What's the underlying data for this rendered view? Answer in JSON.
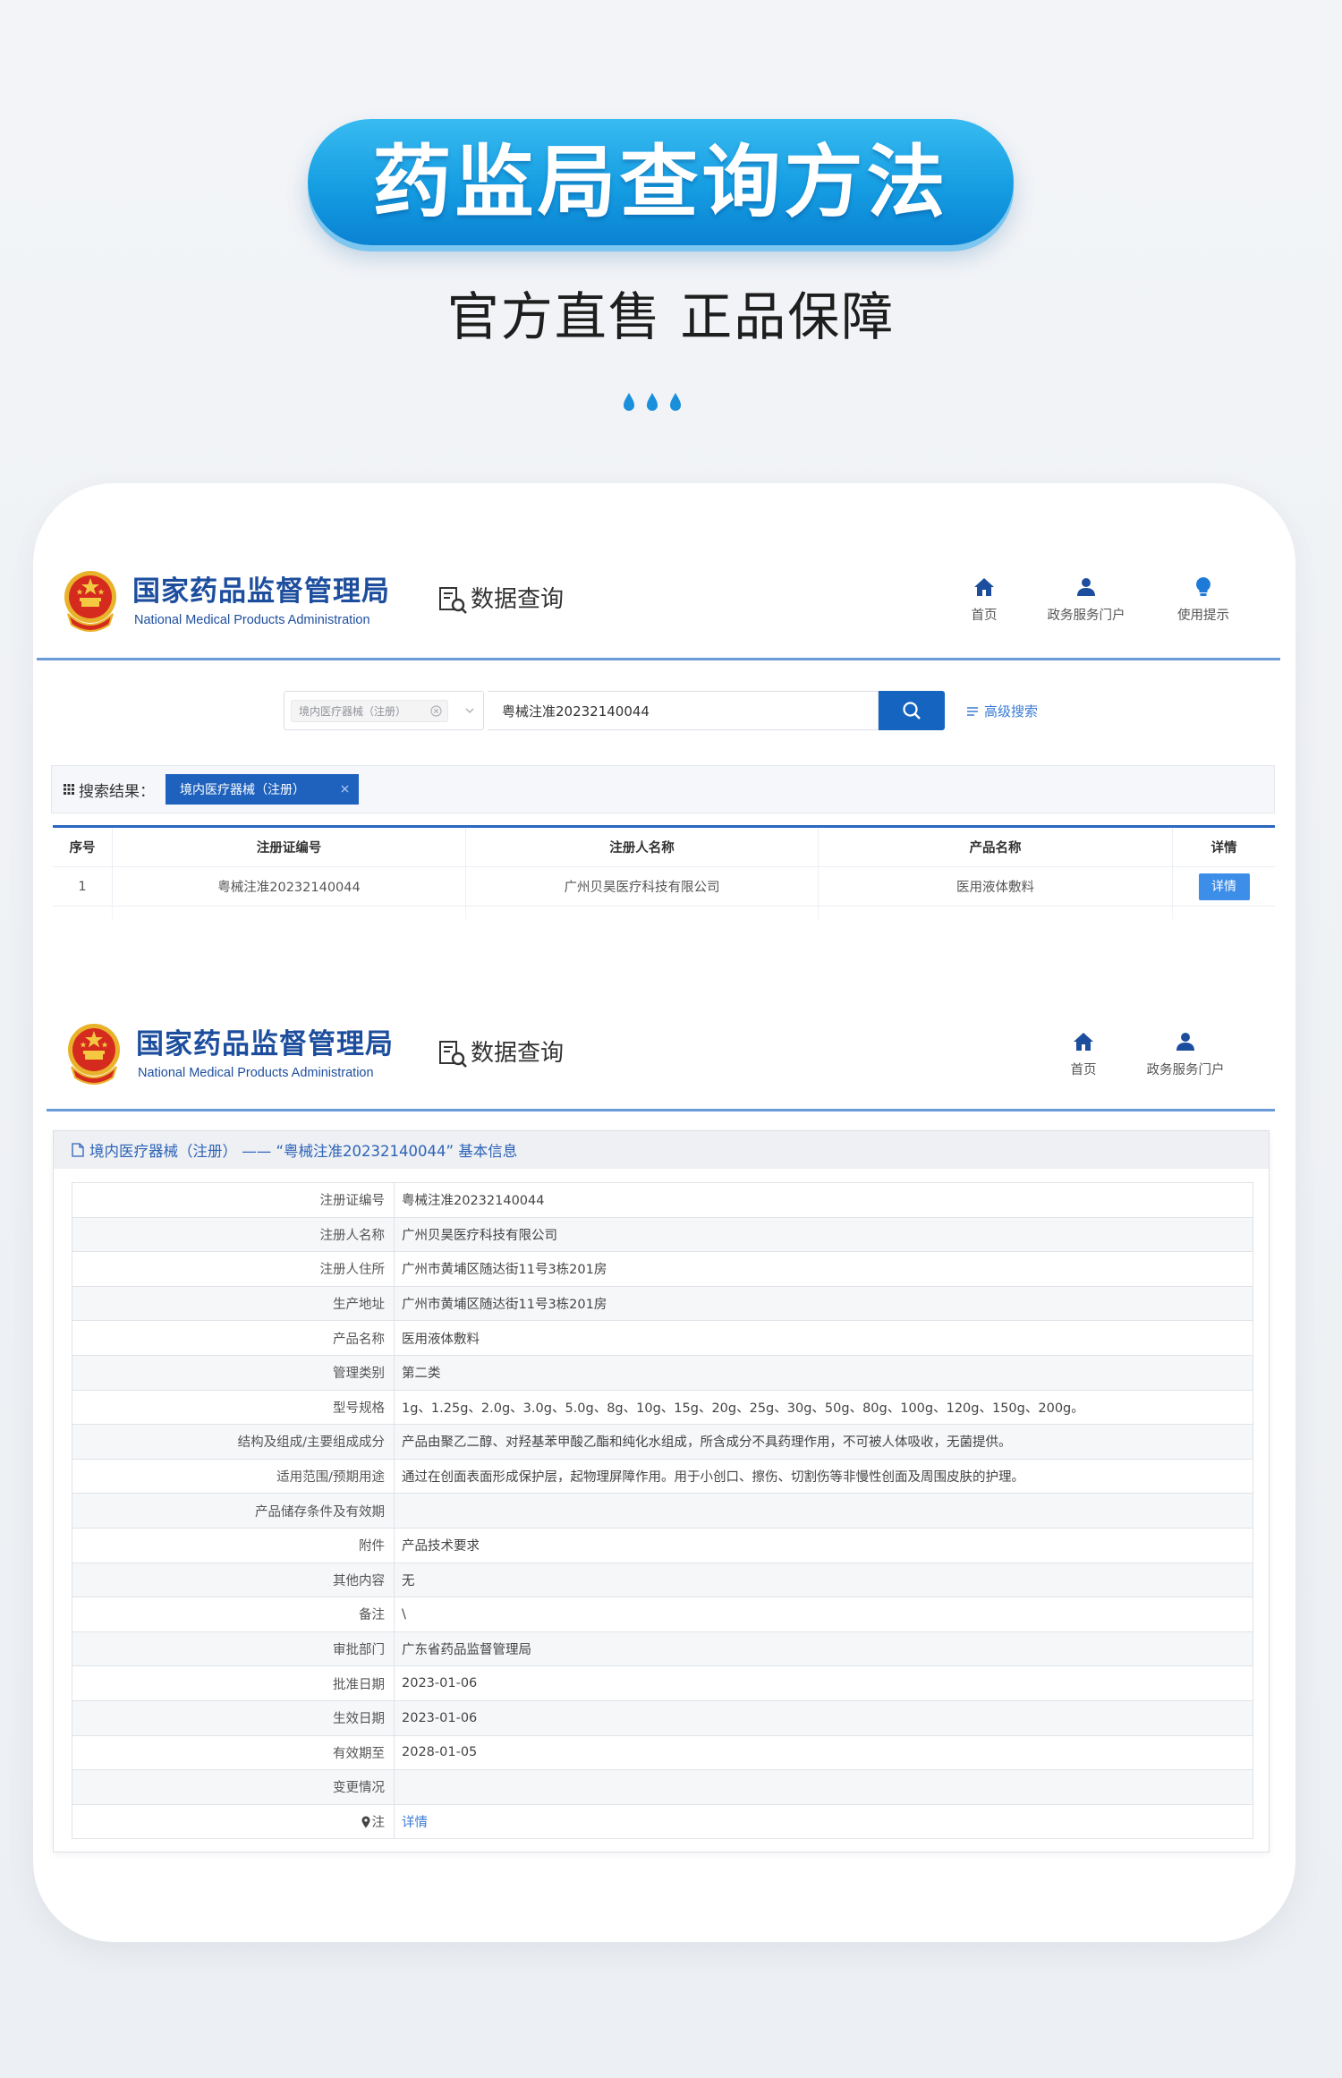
{
  "banner": {
    "title": "药监局查询方法",
    "subtitle": "官方直售 正品保障"
  },
  "site": {
    "name_cn": "国家药品监督管理局",
    "name_en": "National Medical Products Administration",
    "data_query": "数据查询"
  },
  "search_page": {
    "nav": [
      {
        "label": "首页",
        "icon": "home-icon"
      },
      {
        "label": "政务服务门户",
        "icon": "user-icon"
      },
      {
        "label": "使用提示",
        "icon": "bulb-icon"
      }
    ],
    "search": {
      "category": "境内医疗器械（注册）",
      "query": "粤械注准20232140044",
      "advanced_label": "高级搜索"
    },
    "results": {
      "label": "搜索结果：",
      "filter_tag": "境内医疗器械（注册）",
      "columns": [
        "序号",
        "注册证编号",
        "注册人名称",
        "产品名称",
        "详情"
      ],
      "rows": [
        {
          "index": "1",
          "cert_no": "粤械注准20232140044",
          "registrant": "广州贝昊医疗科技有限公司",
          "product": "医用液体敷料",
          "detail_button": "详情"
        }
      ]
    }
  },
  "detail_page": {
    "nav": [
      {
        "label": "首页",
        "icon": "home-icon"
      },
      {
        "label": "政务服务门户",
        "icon": "user-icon"
      }
    ],
    "title": "境内医疗器械（注册） —— “粤械注准20232140044” 基本信息",
    "fields": [
      {
        "label": "注册证编号",
        "value": "粤械注准20232140044"
      },
      {
        "label": "注册人名称",
        "value": "广州贝昊医疗科技有限公司"
      },
      {
        "label": "注册人住所",
        "value": "广州市黄埔区随达街11号3栋201房"
      },
      {
        "label": "生产地址",
        "value": "广州市黄埔区随达街11号3栋201房"
      },
      {
        "label": "产品名称",
        "value": "医用液体敷料"
      },
      {
        "label": "管理类别",
        "value": "第二类"
      },
      {
        "label": "型号规格",
        "value": "1g、1.25g、2.0g、3.0g、5.0g、8g、10g、15g、20g、25g、30g、50g、80g、100g、120g、150g、200g。"
      },
      {
        "label": "结构及组成/主要组成成分",
        "value": "产品由聚乙二醇、对羟基苯甲酸乙酯和纯化水组成，所含成分不具药理作用，不可被人体吸收，无菌提供。"
      },
      {
        "label": "适用范围/预期用途",
        "value": "通过在创面表面形成保护层，起物理屏障作用。用于小创口、擦伤、切割伤等非慢性创面及周围皮肤的护理。"
      },
      {
        "label": "产品储存条件及有效期",
        "value": ""
      },
      {
        "label": "附件",
        "value": "产品技术要求"
      },
      {
        "label": "其他内容",
        "value": "无"
      },
      {
        "label": "备注",
        "value": "\\"
      },
      {
        "label": "审批部门",
        "value": "广东省药品监督管理局"
      },
      {
        "label": "批准日期",
        "value": "2023-01-06"
      },
      {
        "label": "生效日期",
        "value": "2023-01-06"
      },
      {
        "label": "有效期至",
        "value": "2028-01-05"
      },
      {
        "label": "变更情况",
        "value": ""
      },
      {
        "label": "注",
        "value": "详情"
      }
    ]
  },
  "colors": {
    "banner_blue": "#159de2",
    "brand_blue": "#1d4e9e",
    "search_button_blue": "#1565c0",
    "tag_blue": "#1f62be",
    "link_blue": "#3a7bd5",
    "emblem_red": "#d52a1e",
    "emblem_gold": "#e9b22b"
  }
}
